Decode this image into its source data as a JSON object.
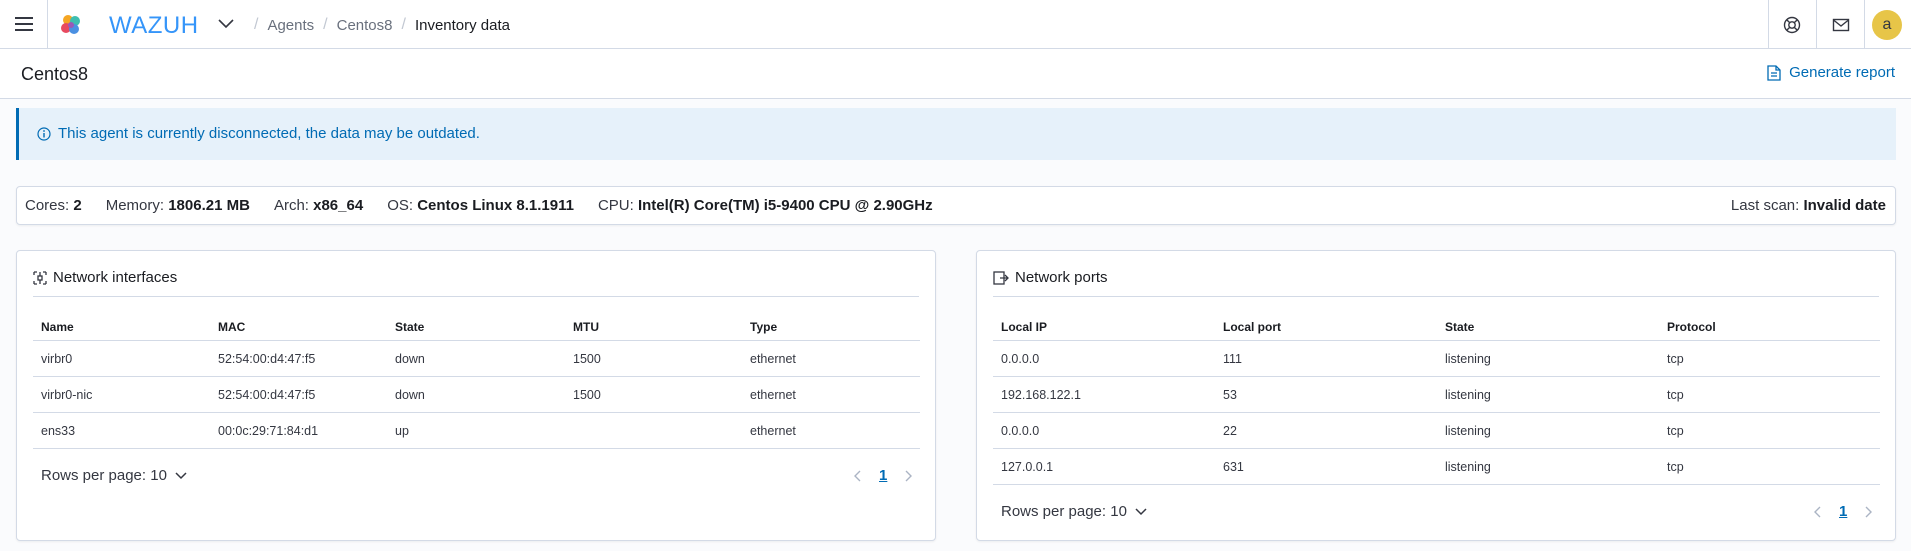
{
  "header": {
    "brand": "WAZUH",
    "breadcrumbs": [
      "Agents",
      "Centos8",
      "Inventory data"
    ],
    "avatar_initial": "a",
    "icons": [
      "menu-icon",
      "wazuh-flower-logo",
      "chevron-down-icon",
      "help-icon",
      "mail-icon"
    ]
  },
  "page": {
    "title": "Centos8",
    "generate_report": "Generate report"
  },
  "callout": {
    "text": "This agent is currently disconnected, the data may be outdated."
  },
  "agent_info": {
    "cores_label": "Cores:",
    "cores": "2",
    "memory_label": "Memory:",
    "memory": "1806.21 MB",
    "arch_label": "Arch:",
    "arch": "x86_64",
    "os_label": "OS:",
    "os": "Centos Linux 8.1.1911",
    "cpu_label": "CPU:",
    "cpu": "Intel(R) Core(TM) i5-9400 CPU @ 2.90GHz",
    "last_scan_label": "Last scan:",
    "last_scan": "Invalid date"
  },
  "network_interfaces": {
    "title": "Network interfaces",
    "columns": [
      "Name",
      "MAC",
      "State",
      "MTU",
      "Type"
    ],
    "rows": [
      [
        "virbr0",
        "52:54:00:d4:47:f5",
        "down",
        "1500",
        "ethernet"
      ],
      [
        "virbr0-nic",
        "52:54:00:d4:47:f5",
        "down",
        "1500",
        "ethernet"
      ],
      [
        "ens33",
        "00:0c:29:71:84:d1",
        "up",
        "",
        "ethernet"
      ]
    ],
    "rows_per_page": "Rows per page: 10",
    "page": "1"
  },
  "network_ports": {
    "title": "Network ports",
    "columns": [
      "Local IP",
      "Local port",
      "State",
      "Protocol"
    ],
    "rows": [
      [
        "0.0.0.0",
        "111",
        "listening",
        "tcp"
      ],
      [
        "192.168.122.1",
        "53",
        "listening",
        "tcp"
      ],
      [
        "0.0.0.0",
        "22",
        "listening",
        "tcp"
      ],
      [
        "127.0.0.1",
        "631",
        "listening",
        "tcp"
      ]
    ],
    "rows_per_page": "Rows per page: 10",
    "page": "1"
  },
  "colors": {
    "accent": "#006bb4",
    "avatar": "#e7c548",
    "callout_bg": "#e6f1fa"
  }
}
